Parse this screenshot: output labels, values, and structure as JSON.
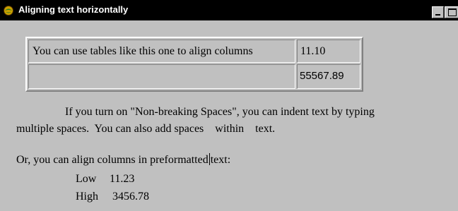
{
  "window": {
    "title": "Aligning text horizontally",
    "icon": "netscape-globe-icon",
    "colors": {
      "titlebar_bg": "#000000",
      "titlebar_text": "#ffffff",
      "content_bg": "#c0c0c0"
    }
  },
  "table": {
    "rows": [
      [
        "You can use tables like this one to align columns",
        "11.10"
      ],
      [
        "",
        "55567.89"
      ]
    ]
  },
  "paragraph1": {
    "line1": "If you turn on \"Non-breaking Spaces\", you can indent text by typing",
    "line2": "multiple spaces.  You can also add spaces    within    text."
  },
  "paragraph2": {
    "before_caret": "Or, you can align columns in preformatted",
    "after_caret": "text:"
  },
  "preformatted": [
    {
      "label": "Low",
      "value": "11.23"
    },
    {
      "label": "High",
      "value": "3456.78"
    }
  ]
}
